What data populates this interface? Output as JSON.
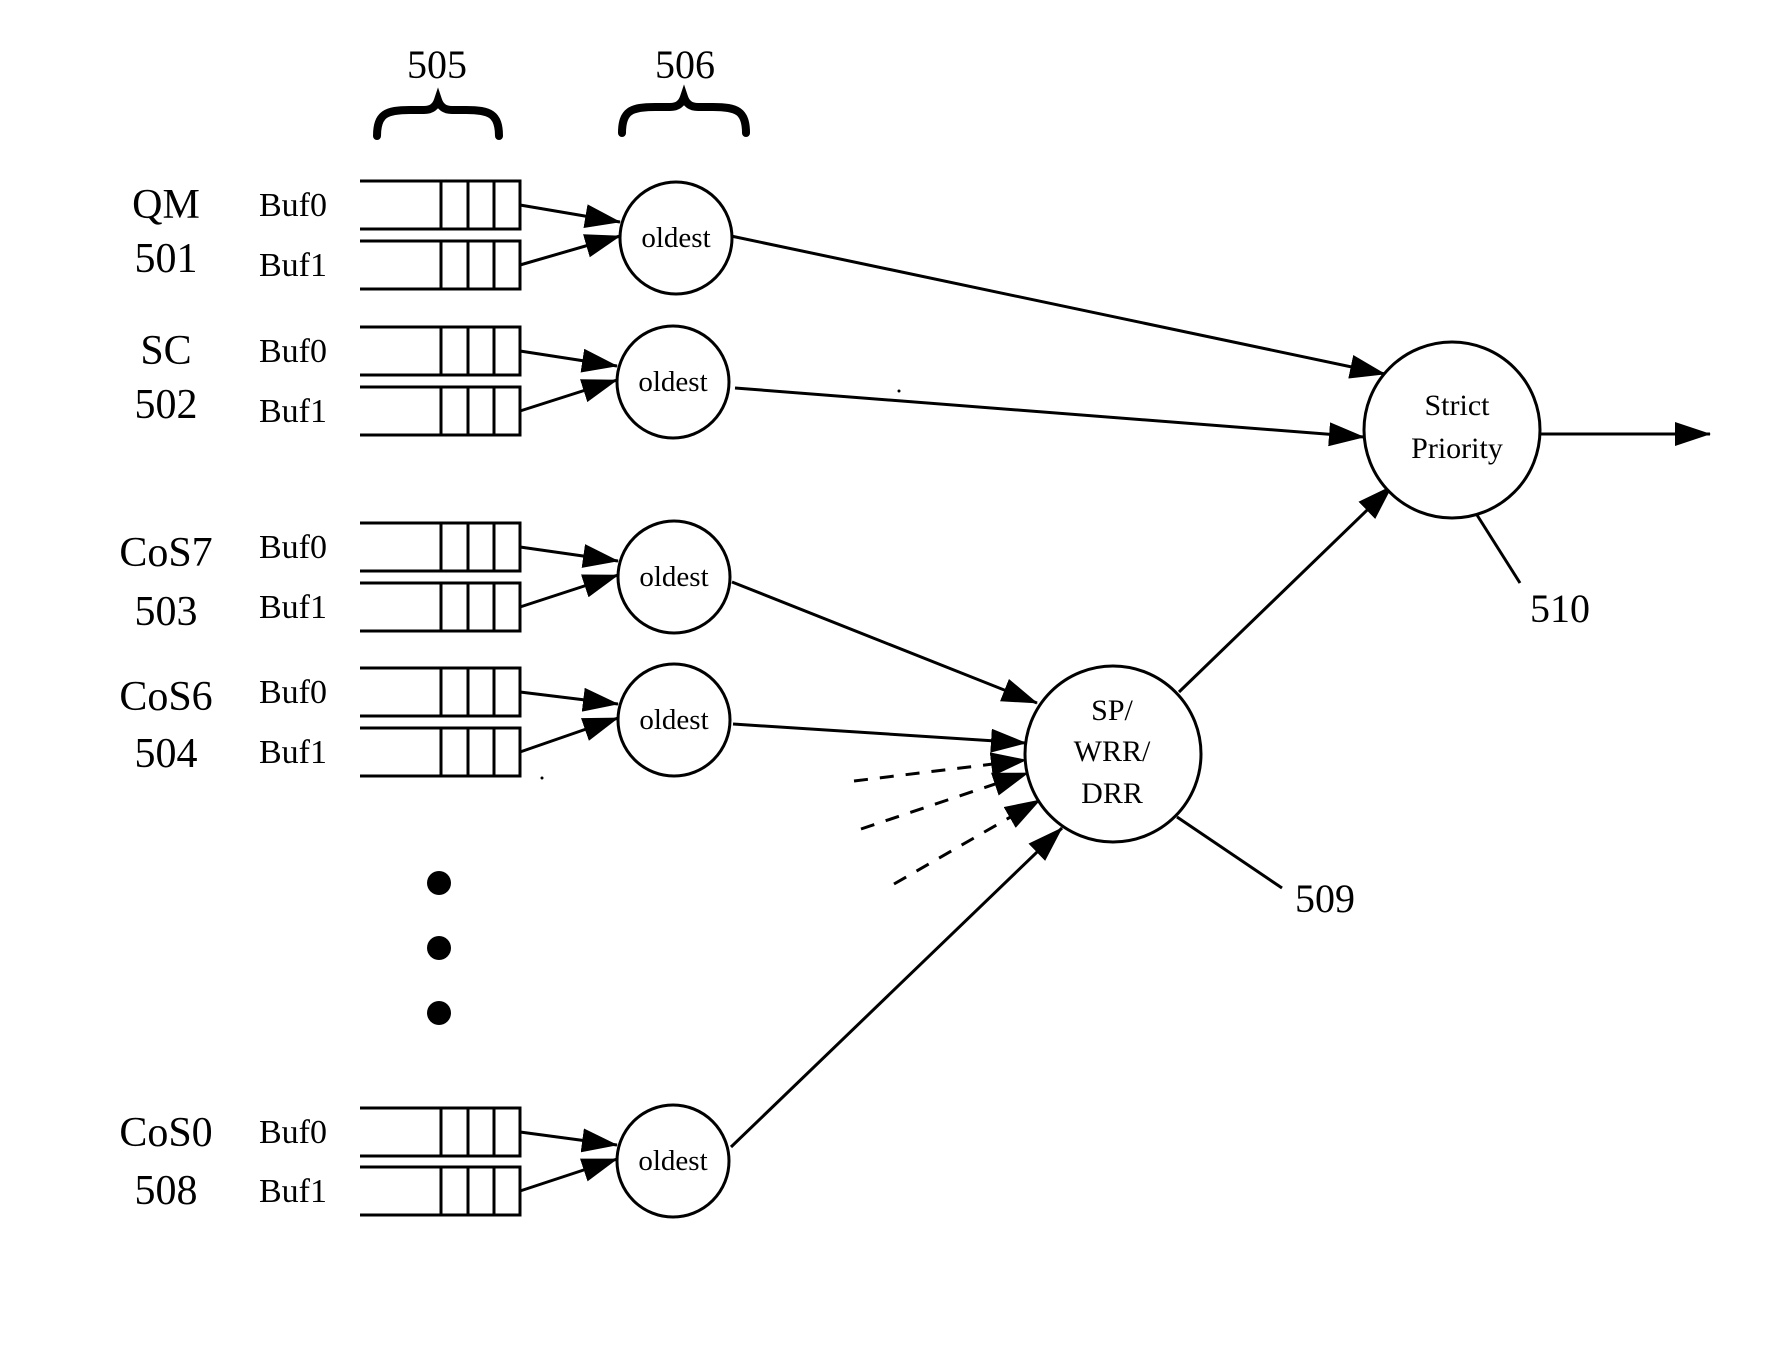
{
  "figure": {
    "type": "queue scheduling block diagram",
    "reference_labels": {
      "buffers_group": "505",
      "oldest_selectors_group": "506",
      "scheduler": "509",
      "strict_priority": "510"
    },
    "queue_groups": [
      {
        "name": "QM",
        "ref": "501",
        "buffers": [
          "Buf0",
          "Buf1"
        ],
        "selector": "oldest",
        "feeds": "strict_priority"
      },
      {
        "name": "SC",
        "ref": "502",
        "buffers": [
          "Buf0",
          "Buf1"
        ],
        "selector": "oldest",
        "feeds": "strict_priority"
      },
      {
        "name": "CoS7",
        "ref": "503",
        "buffers": [
          "Buf0",
          "Buf1"
        ],
        "selector": "oldest",
        "feeds": "scheduler"
      },
      {
        "name": "CoS6",
        "ref": "504",
        "buffers": [
          "Buf0",
          "Buf1"
        ],
        "selector": "oldest",
        "feeds": "scheduler"
      },
      {
        "name": "CoS0",
        "ref": "508",
        "buffers": [
          "Buf0",
          "Buf1"
        ],
        "selector": "oldest",
        "feeds": "scheduler"
      }
    ],
    "ellipsis": "...",
    "scheduler": {
      "lines": [
        "SP/",
        "WRR/",
        "DRR"
      ]
    },
    "strict_priority": {
      "lines": [
        "Strict",
        "Priority"
      ]
    }
  }
}
